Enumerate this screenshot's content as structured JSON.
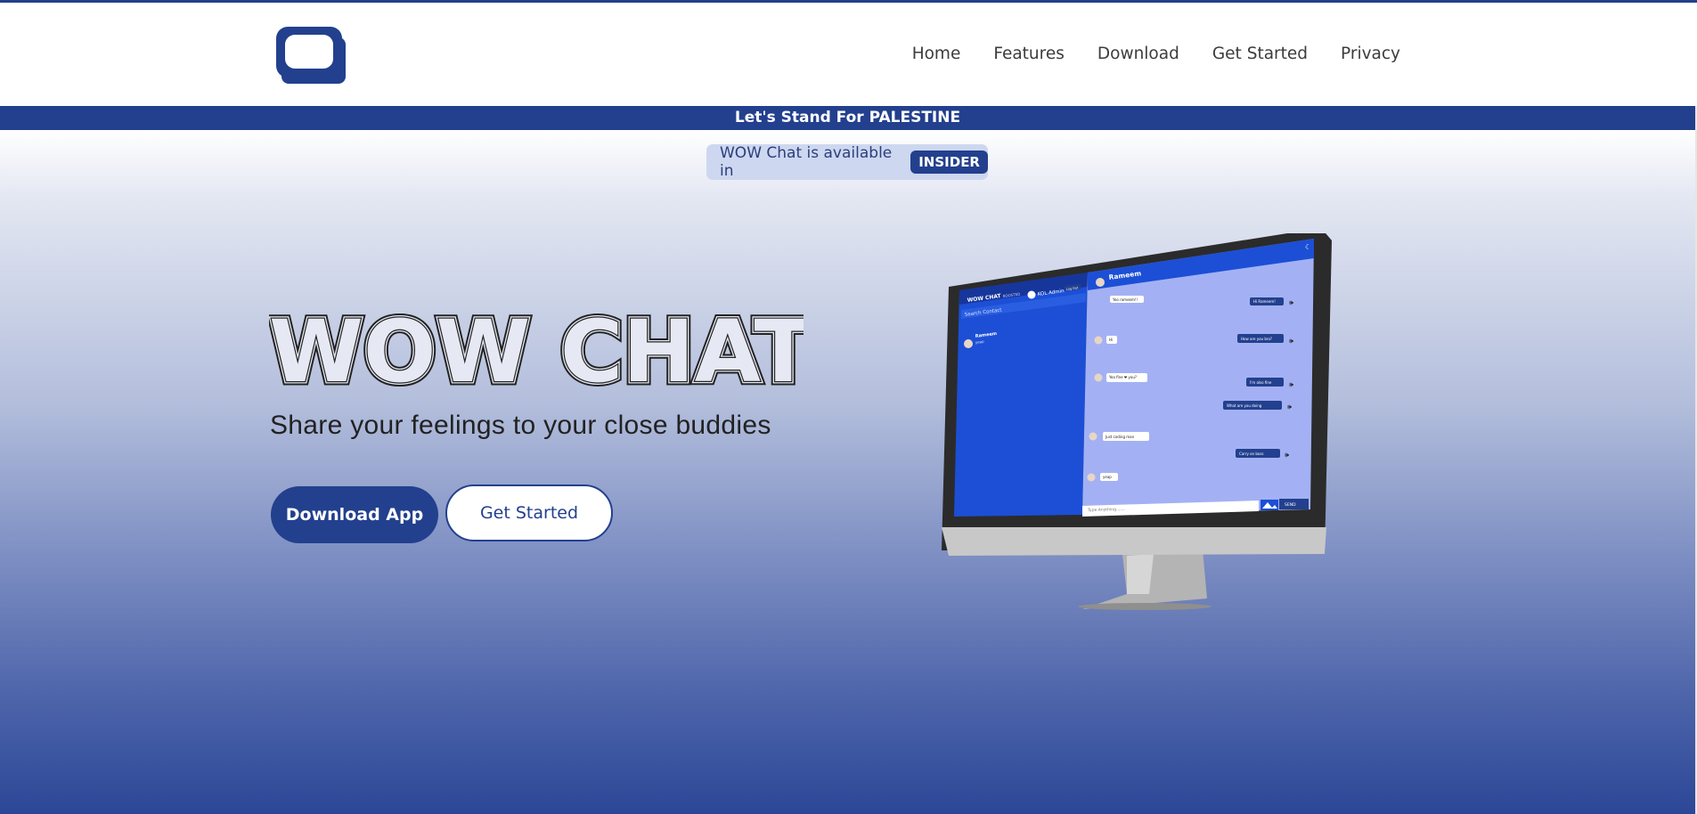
{
  "nav": {
    "logo": "wow-chat-logo",
    "links": [
      "Home",
      "Features",
      "Download",
      "Get Started",
      "Privacy"
    ]
  },
  "banner": {
    "text": "Let's Stand For PALESTINE"
  },
  "availability": {
    "text": "WOW Chat is available in",
    "badge": "INSIDER"
  },
  "hero": {
    "title": "WOW CHAT",
    "subtitle": "Share your feelings to your close buddies",
    "download_label": "Download App",
    "get_started_label": "Get Started"
  },
  "mockup": {
    "app_name": "WOW CHAT",
    "app_tag": "BOOSTED",
    "user": "KOL Admin",
    "logout": "Log Out",
    "search_placeholder": "Search Contact",
    "contact_name": "Rameem",
    "contact_preview": "yeap",
    "chat_header": "Rameem",
    "messages": [
      {
        "side": "in",
        "text": "Yoo rameem!!"
      },
      {
        "side": "out",
        "text": "Hi Rameem!"
      },
      {
        "side": "in",
        "text": "Hi"
      },
      {
        "side": "out",
        "text": "How are you bro?"
      },
      {
        "side": "in",
        "text": "Yea fine ❤ you?"
      },
      {
        "side": "out",
        "text": "I'm also fine"
      },
      {
        "side": "out",
        "text": "What are you doing"
      },
      {
        "side": "in",
        "text": "Just coding man"
      },
      {
        "side": "out",
        "text": "Carry on boss"
      },
      {
        "side": "in",
        "text": "yeap"
      }
    ],
    "input_placeholder": "Type Anything.......",
    "send_label": "SEND"
  },
  "colors": {
    "brand": "#23408e",
    "app_blue": "#1c4fd6",
    "chat_bg": "#a3b1f4"
  }
}
